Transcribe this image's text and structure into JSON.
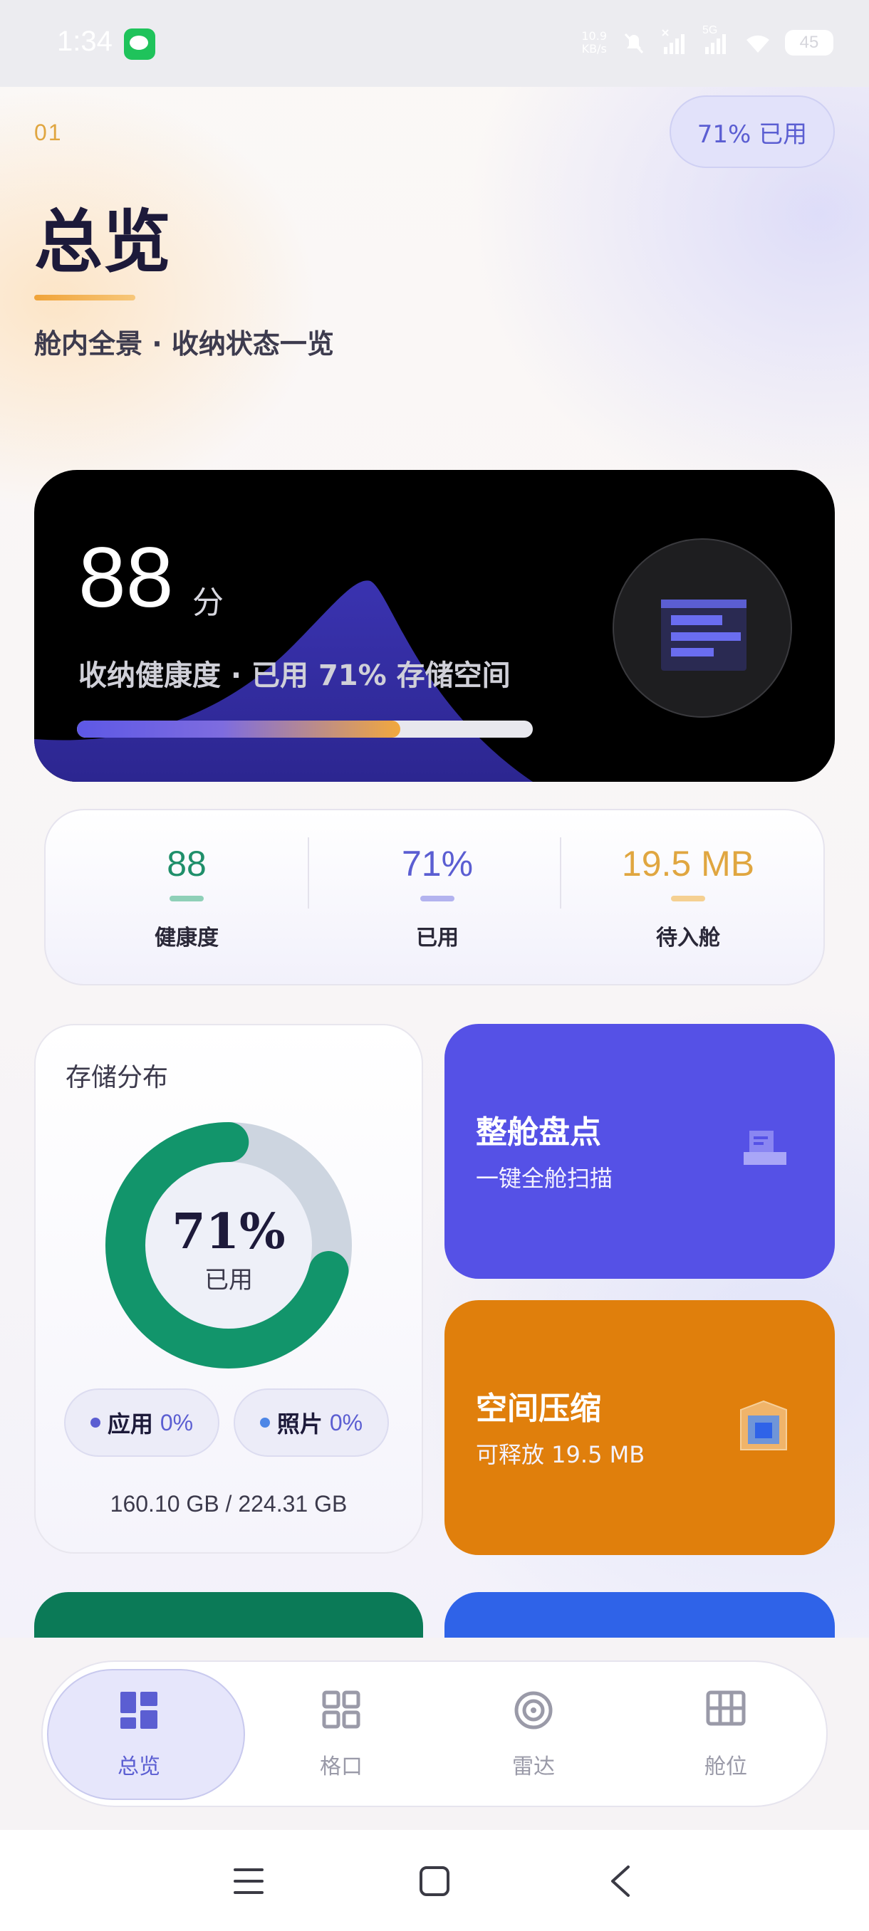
{
  "status_bar": {
    "time": "1:34",
    "speed": "10.9",
    "speed_unit": "KB/s",
    "network": "5G",
    "battery": "45"
  },
  "header": {
    "section_number": "01",
    "usage_pill": "71% 已用",
    "title": "总览",
    "subtitle": "舱内全景 · 收纳状态一览"
  },
  "health_card": {
    "score": "88",
    "score_unit": "分",
    "caption": "收纳健康度 · 已用 71% 存储空间",
    "progress_fraction": 0.71,
    "icon": "document-list-icon"
  },
  "stats": [
    {
      "value": "88",
      "label": "健康度",
      "color": "#1f8f6a",
      "dash_color": "#8fd0b8"
    },
    {
      "value": "71%",
      "label": "已用",
      "color": "#5b5ed2",
      "dash_color": "#b3b3ef"
    },
    {
      "value": "19.5 MB",
      "label": "待入舱",
      "color": "#e0a640",
      "dash_color": "#f5d092"
    }
  ],
  "storage": {
    "title": "存储分布",
    "used_fraction": 0.71,
    "percent_text": "71%",
    "percent_sub": "已用",
    "used_color": "#12956b",
    "free_color": "#cdd5e0",
    "chips": [
      {
        "label": "应用",
        "value": "0%",
        "dot_color": "#5b5ed2"
      },
      {
        "label": "照片",
        "value": "0%",
        "dot_color": "#4d86e6"
      }
    ],
    "total": "160.10 GB / 224.31 GB"
  },
  "actions": [
    {
      "title": "整舱盘点",
      "subtitle": "一键全舱扫描",
      "color": "#5551e6",
      "icon": "inventory-box-icon"
    },
    {
      "title": "空间压缩",
      "subtitle": "可释放 19.5 MB",
      "color": "#e07f0c",
      "icon": "compress-frame-icon"
    }
  ],
  "peek_cards": [
    {
      "color": "#0b7a57"
    },
    {
      "color": "#2f63e8"
    }
  ],
  "bottom_nav": [
    {
      "label": "总览",
      "icon": "dashboard-icon",
      "active": true
    },
    {
      "label": "格口",
      "icon": "grid-icon",
      "active": false
    },
    {
      "label": "雷达",
      "icon": "radar-icon",
      "active": false
    },
    {
      "label": "舱位",
      "icon": "table-icon",
      "active": false
    }
  ],
  "system_nav": [
    "menu-icon",
    "home-icon",
    "back-icon"
  ]
}
